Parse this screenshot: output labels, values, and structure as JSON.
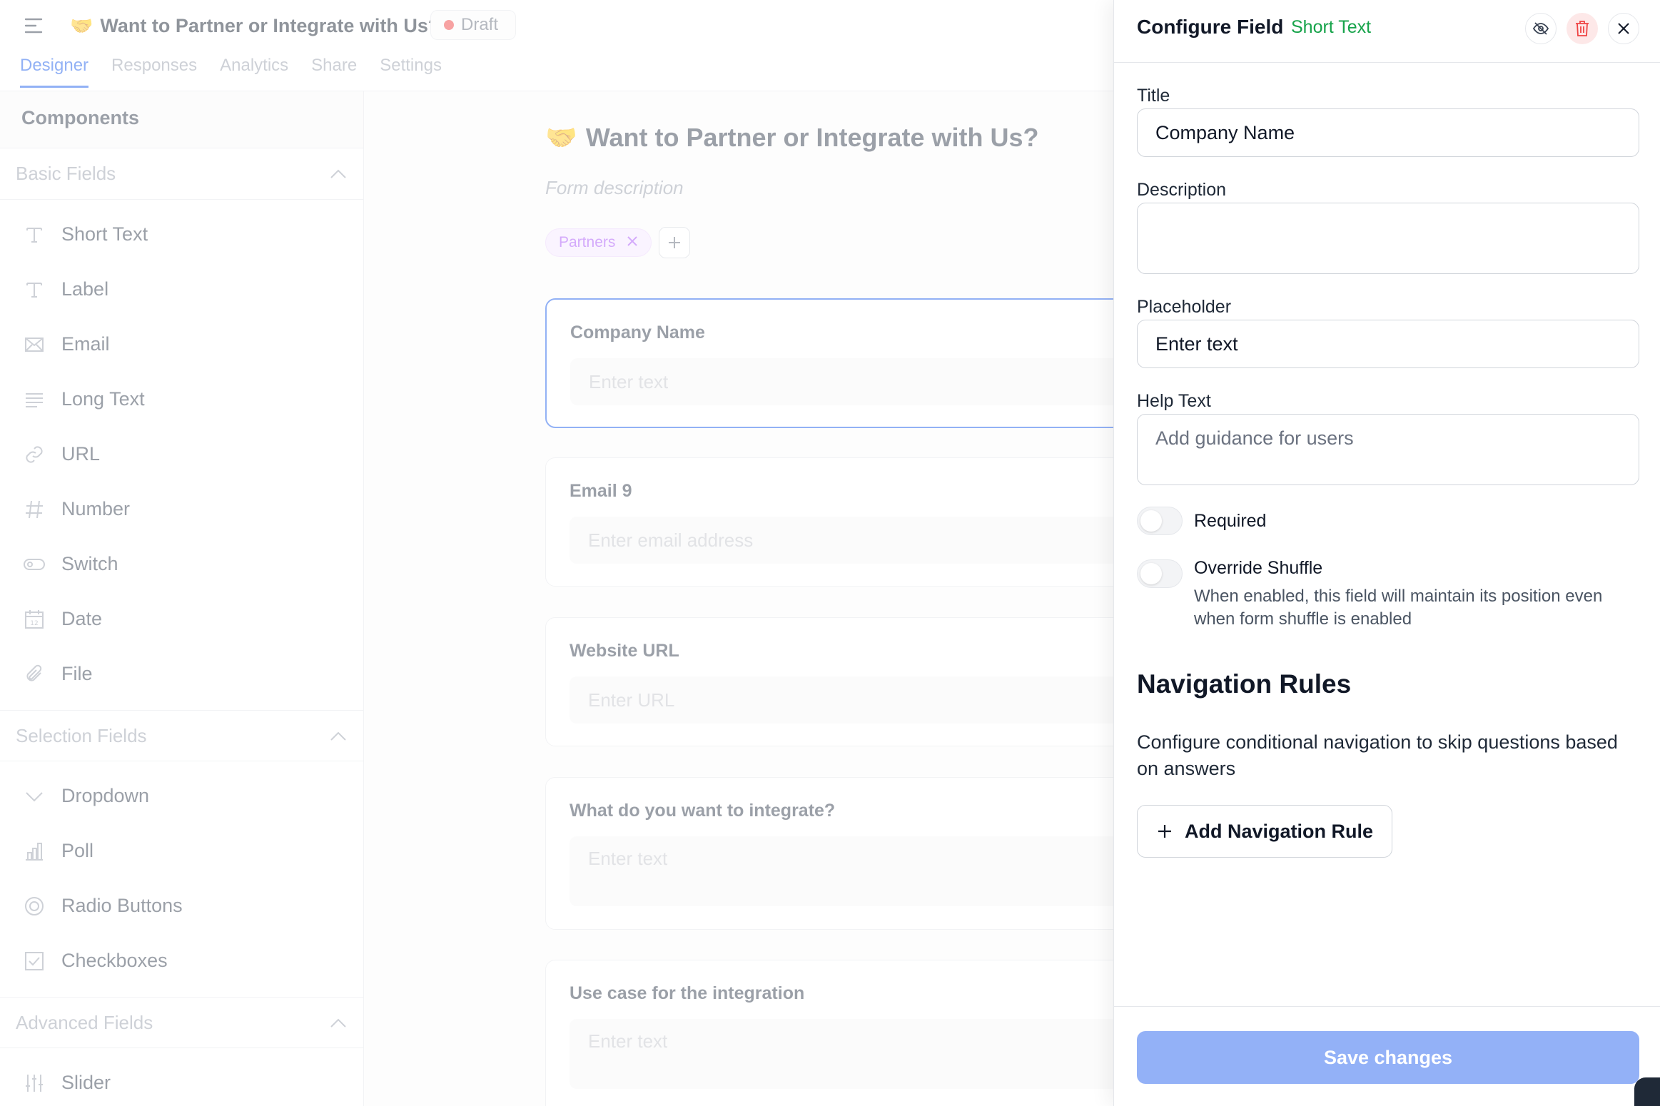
{
  "header": {
    "title_emoji": "🤝",
    "title": "Want to Partner or Integrate with Us?",
    "status": "Draft",
    "tabs": [
      "Designer",
      "Responses",
      "Analytics",
      "Share",
      "Settings"
    ],
    "active_tab": "Designer"
  },
  "sidebar": {
    "title": "Components",
    "sections": [
      {
        "name": "Basic Fields",
        "items": [
          {
            "label": "Short Text",
            "icon": "text-icon"
          },
          {
            "label": "Label",
            "icon": "text-icon"
          },
          {
            "label": "Email",
            "icon": "mail-icon"
          },
          {
            "label": "Long Text",
            "icon": "lines-icon"
          },
          {
            "label": "URL",
            "icon": "link-icon"
          },
          {
            "label": "Number",
            "icon": "hash-icon"
          },
          {
            "label": "Switch",
            "icon": "toggle-icon"
          },
          {
            "label": "Date",
            "icon": "calendar-icon"
          },
          {
            "label": "File",
            "icon": "paperclip-icon"
          }
        ]
      },
      {
        "name": "Selection Fields",
        "items": [
          {
            "label": "Dropdown",
            "icon": "chevron-down-icon"
          },
          {
            "label": "Poll",
            "icon": "bar-chart-icon"
          },
          {
            "label": "Radio Buttons",
            "icon": "radio-icon"
          },
          {
            "label": "Checkboxes",
            "icon": "checkbox-icon"
          }
        ]
      },
      {
        "name": "Advanced Fields",
        "items": [
          {
            "label": "Slider",
            "icon": "sliders-icon"
          }
        ]
      }
    ]
  },
  "form": {
    "title_emoji": "🤝",
    "title": "Want to Partner or Integrate with Us?",
    "description_placeholder": "Form description",
    "tags": [
      "Partners"
    ],
    "fields": [
      {
        "label": "Company Name",
        "placeholder": "Enter text",
        "selected": true
      },
      {
        "label": "Email 9",
        "placeholder": "Enter email address"
      },
      {
        "label": "Website URL",
        "placeholder": "Enter URL"
      },
      {
        "label": "What do you want to integrate?",
        "placeholder": "Enter text"
      },
      {
        "label": "Use case for the integration",
        "placeholder": "Enter text"
      }
    ]
  },
  "panel": {
    "title": "Configure Field",
    "field_type": "Short Text",
    "title_label": "Title",
    "title_value": "Company Name",
    "description_label": "Description",
    "description_value": "",
    "placeholder_label": "Placeholder",
    "placeholder_value": "Enter text",
    "help_label": "Help Text",
    "help_placeholder": "Add guidance for users",
    "required_label": "Required",
    "required_on": false,
    "override_label": "Override Shuffle",
    "override_on": false,
    "override_help": "When enabled, this field will maintain its position even when form shuffle is enabled",
    "nav_title": "Navigation Rules",
    "nav_desc": "Configure conditional navigation to skip questions based on answers",
    "add_nav_label": "Add Navigation Rule",
    "save_label": "Save changes"
  },
  "colors": {
    "accent": "#2563eb",
    "success": "#16a34a",
    "danger": "#ef4444",
    "save_button": "#93b1f7",
    "tag": "#a855f7"
  }
}
